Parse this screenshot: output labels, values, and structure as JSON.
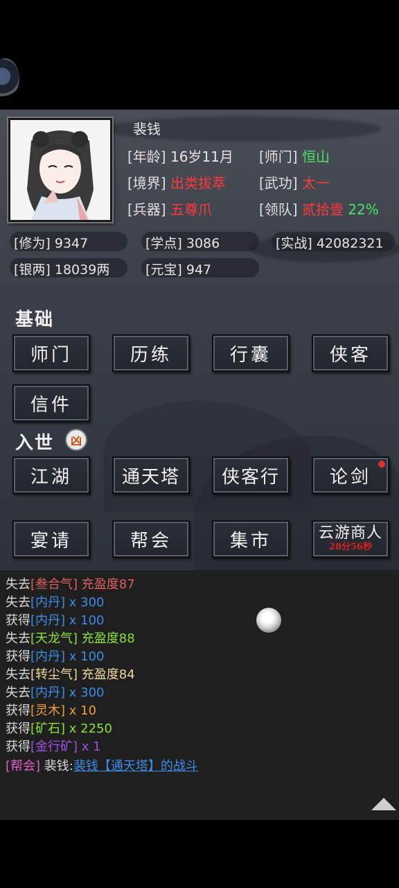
{
  "profile": {
    "name": "裴钱",
    "age_label": "[年龄]",
    "age": "16岁11月",
    "master_label": "[师门]",
    "master": "恒山",
    "realm_label": "[境界]",
    "realm": "出类拔萃",
    "martial_label": "[武功]",
    "martial": "太一",
    "weapon_label": "[兵器]",
    "weapon": "五尊爪",
    "leader_label": "[领队]",
    "leader": "贰拾壹",
    "leader_pct": "22%"
  },
  "stats": {
    "cultivation_label": "[修为]",
    "cultivation": "9347",
    "study_label": "[学点]",
    "study": "3086",
    "combat_label": "[实战]",
    "combat": "42082321",
    "silver_label": "[银两]",
    "silver": "18039两",
    "ingot_label": "[元宝]",
    "ingot": "947"
  },
  "sections": {
    "basic": "基础",
    "world": "入世",
    "world_badge": "凶"
  },
  "buttons": {
    "sect": "师门",
    "train": "历练",
    "bag": "行囊",
    "hero": "侠客",
    "mail": "信件",
    "jianghu": "江湖",
    "tower": "通天塔",
    "hero_travel": "侠客行",
    "duel": "论剑",
    "banquet": "宴请",
    "guild": "帮会",
    "market": "集市",
    "merchant": "云游商人",
    "merchant_timer": "28分56秒"
  },
  "log": [
    {
      "prefix": "失去",
      "item": "[叁合气]",
      "suffix": " 充盈度87"
    },
    {
      "prefix": "失去",
      "item": "[内丹]",
      "suffix": " x 300"
    },
    {
      "prefix": "获得",
      "item": "[内丹]",
      "suffix": " x 100"
    },
    {
      "prefix": "失去",
      "item": "[天龙气]",
      "suffix": " 充盈度88"
    },
    {
      "prefix": "获得",
      "item": "[内丹]",
      "suffix": " x 100"
    },
    {
      "prefix": "失去",
      "item": "[转尘气]",
      "suffix": " 充盈度84"
    },
    {
      "prefix": "失去",
      "item": "[内丹]",
      "suffix": " x 300"
    },
    {
      "prefix": "获得",
      "item": "[灵木]",
      "suffix": " x 10"
    },
    {
      "prefix": "获得",
      "item": "[矿石]",
      "suffix": " x 2250"
    },
    {
      "prefix": "获得",
      "item": "[金行矿]",
      "suffix": " x 1"
    },
    {
      "prefix": "[帮会]",
      "item": " 裴钱:",
      "suffix": "裴钱【通天塔】的战斗"
    }
  ],
  "colors": {
    "red": "#ff3b3b",
    "green": "#4ee36a",
    "panel": "#3c414b"
  }
}
